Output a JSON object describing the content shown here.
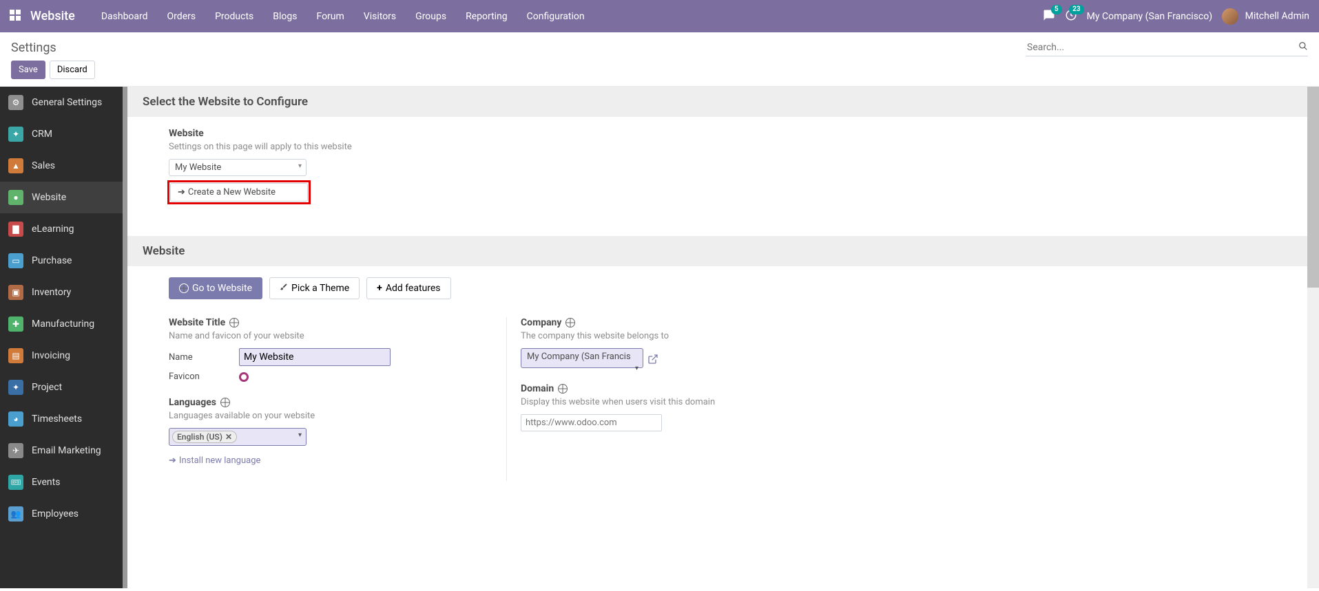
{
  "nav": {
    "brand": "Website",
    "items": [
      "Dashboard",
      "Orders",
      "Products",
      "Blogs",
      "Forum",
      "Visitors",
      "Groups",
      "Reporting",
      "Configuration"
    ],
    "chat_badge": "5",
    "clock_badge": "23",
    "company": "My Company (San Francisco)",
    "user": "Mitchell Admin"
  },
  "cp": {
    "title": "Settings",
    "search_placeholder": "Search...",
    "save": "Save",
    "discard": "Discard"
  },
  "sidebar": [
    {
      "label": "General Settings",
      "color": "#8f8f8f"
    },
    {
      "label": "CRM",
      "color": "#3aa6a6"
    },
    {
      "label": "Sales",
      "color": "#d07b3a"
    },
    {
      "label": "Website",
      "color": "#5fb36b",
      "active": true
    },
    {
      "label": "eLearning",
      "color": "#c84b4b"
    },
    {
      "label": "Purchase",
      "color": "#4a9fcf"
    },
    {
      "label": "Inventory",
      "color": "#b06a45"
    },
    {
      "label": "Manufacturing",
      "color": "#4fb36b"
    },
    {
      "label": "Invoicing",
      "color": "#d07b3a"
    },
    {
      "label": "Project",
      "color": "#3a6fa6"
    },
    {
      "label": "Timesheets",
      "color": "#4a9fcf"
    },
    {
      "label": "Email Marketing",
      "color": "#8a8a8a"
    },
    {
      "label": "Events",
      "color": "#2fa6a6"
    },
    {
      "label": "Employees",
      "color": "#5a9fcf"
    }
  ],
  "sections": {
    "select_site": {
      "header": "Select the Website to Configure",
      "block_title": "Website",
      "block_desc": "Settings on this page will apply to this website",
      "selected": "My Website",
      "create": "Create a New Website"
    },
    "website": {
      "header": "Website",
      "go": "Go to Website",
      "theme": "Pick a Theme",
      "features": "Add features",
      "title_block": {
        "title": "Website Title",
        "desc": "Name and favicon of your website",
        "name_label": "Name",
        "name_value": "My Website",
        "favicon_label": "Favicon"
      },
      "company_block": {
        "title": "Company",
        "desc": "The company this website belongs to",
        "value": "My Company (San Francisco)"
      },
      "lang_block": {
        "title": "Languages",
        "desc": "Languages available on your website",
        "chip": "English (US)",
        "install": "Install new language"
      },
      "domain_block": {
        "title": "Domain",
        "desc": "Display this website when users visit this domain",
        "placeholder": "https://www.odoo.com"
      }
    }
  }
}
